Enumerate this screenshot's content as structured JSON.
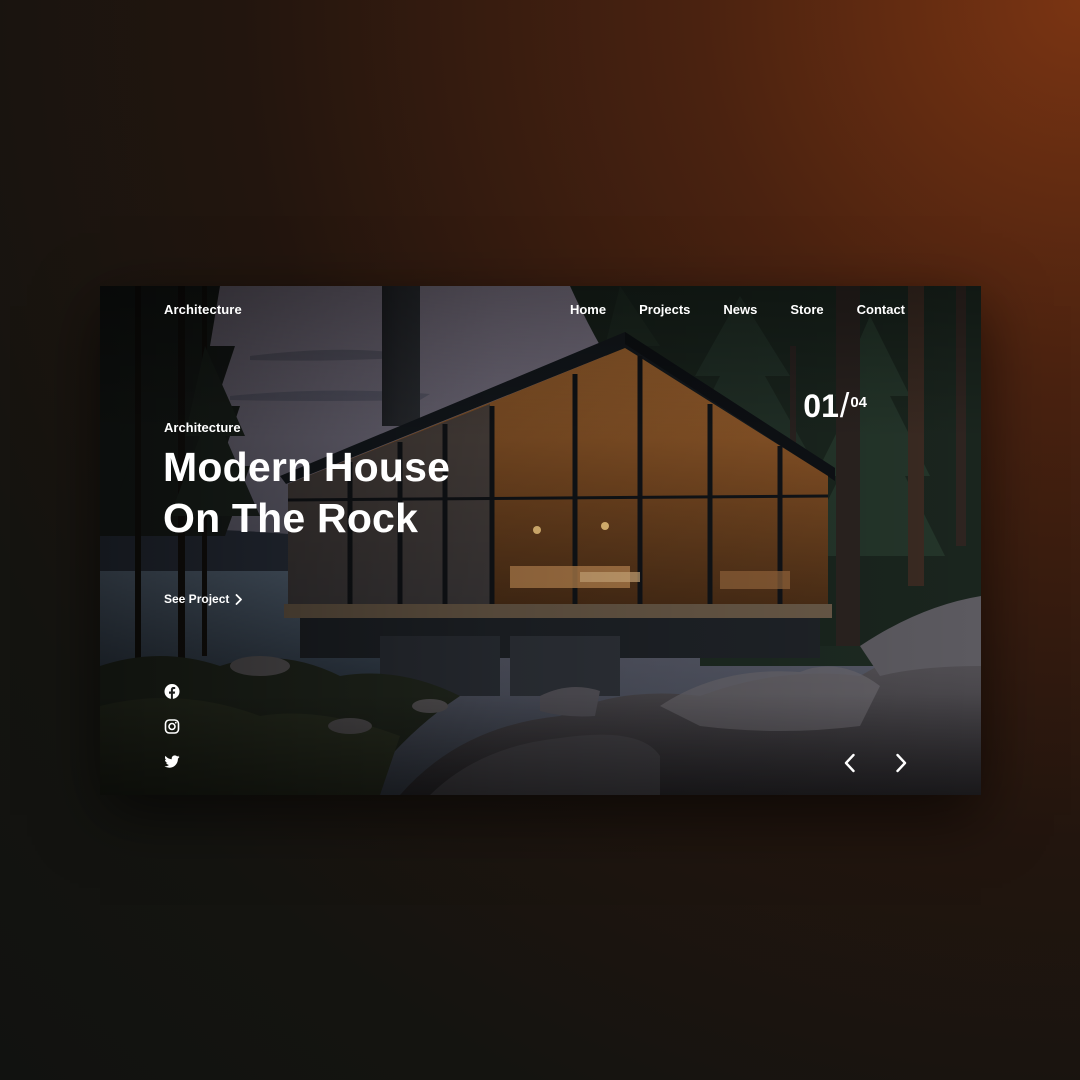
{
  "header": {
    "brand": "Architecture",
    "nav": [
      "Home",
      "Projects",
      "News",
      "Store",
      "Contact"
    ]
  },
  "slider": {
    "current": "01",
    "separator": "/",
    "total": "04"
  },
  "hero": {
    "eyebrow": "Architecture",
    "title_line1": "Modern House",
    "title_line2": "On The Rock",
    "cta_label": "See Project"
  },
  "social": [
    "facebook-icon",
    "instagram-icon",
    "twitter-icon"
  ],
  "controls": [
    "chevron-left-icon",
    "chevron-right-icon"
  ],
  "colors": {
    "text": "#ffffff",
    "bg_accent": "#7a3412",
    "bg_dark": "#121310"
  }
}
